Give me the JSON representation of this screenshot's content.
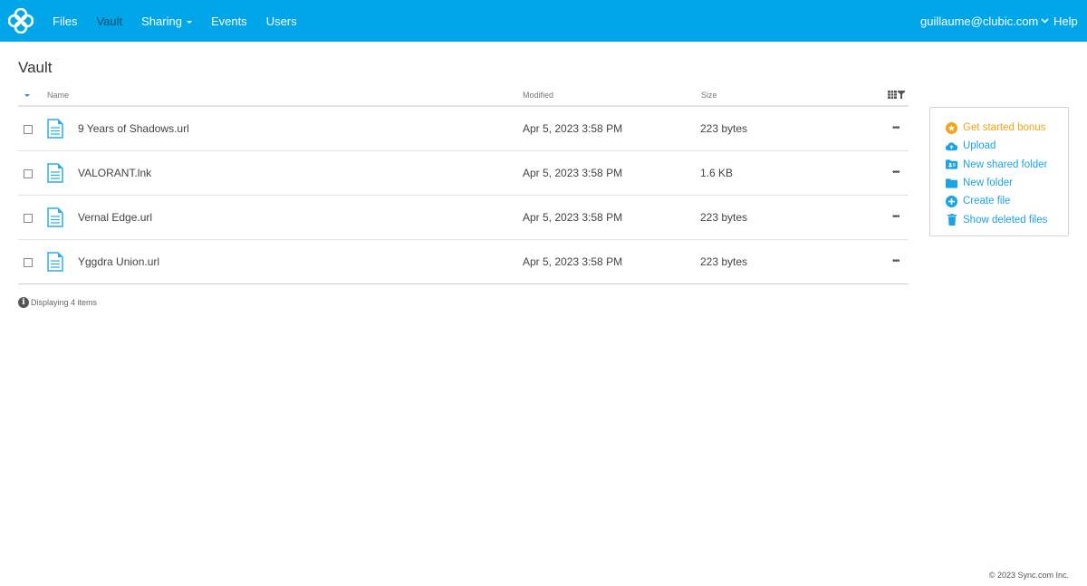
{
  "topbar": {
    "logo_icon": "sync-logo-icon",
    "nav": [
      {
        "label": "Files",
        "active": false
      },
      {
        "label": "Vault",
        "active": true
      },
      {
        "label": "Sharing",
        "active": false,
        "dropdown": true
      },
      {
        "label": "Events",
        "active": false
      },
      {
        "label": "Users",
        "active": false
      }
    ],
    "user_email": "guillaume@clubic.com",
    "help_label": "Help"
  },
  "page": {
    "title": "Vault"
  },
  "table": {
    "columns": {
      "name": "Name",
      "modified": "Modified",
      "size": "Size"
    },
    "rows": [
      {
        "name": "9 Years of Shadows.url",
        "modified": "Apr 5, 2023 3:58 PM",
        "size": "223 bytes"
      },
      {
        "name": "VALORANT.lnk",
        "modified": "Apr 5, 2023 3:58 PM",
        "size": "1.6 KB"
      },
      {
        "name": "Vernal Edge.url",
        "modified": "Apr 5, 2023 3:58 PM",
        "size": "223 bytes"
      },
      {
        "name": "Yggdra Union.url",
        "modified": "Apr 5, 2023 3:58 PM",
        "size": "223 bytes"
      }
    ],
    "more_label": "•••",
    "status_text": "Displaying 4 items"
  },
  "actions": [
    {
      "label": "Get started bonus",
      "icon": "star-circle-icon"
    },
    {
      "label": "Upload",
      "icon": "cloud-upload-icon"
    },
    {
      "label": "New shared folder",
      "icon": "shared-folder-icon"
    },
    {
      "label": "New folder",
      "icon": "folder-icon"
    },
    {
      "label": "Create file",
      "icon": "plus-circle-icon"
    },
    {
      "label": "Show deleted files",
      "icon": "trash-icon"
    }
  ],
  "colors": {
    "topbar": "#00a6e8",
    "accent": "#1aa4e2",
    "bonus": "#f5a31a",
    "active_nav": "#0a4f73"
  },
  "footer": {
    "copyright": "© 2023 Sync.com Inc."
  }
}
